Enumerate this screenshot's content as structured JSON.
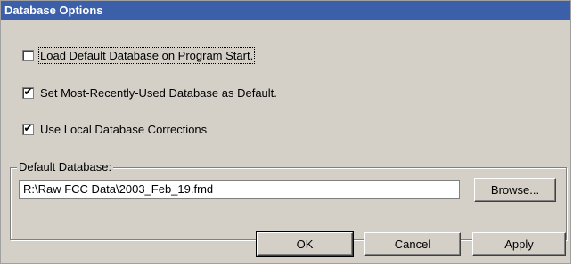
{
  "dialog": {
    "title": "Database Options"
  },
  "options": [
    {
      "label": "Load Default Database on Program Start.",
      "checked": false
    },
    {
      "label": "Set Most-Recently-Used Database as Default.",
      "checked": true
    },
    {
      "label": "Use Local Database Corrections",
      "checked": true
    }
  ],
  "default_database": {
    "group_label": "Default Database:",
    "value": "R:\\Raw FCC Data\\2003_Feb_19.fmd",
    "browse_label": "Browse..."
  },
  "buttons": {
    "ok": "OK",
    "cancel": "Cancel",
    "apply": "Apply"
  },
  "checkmark": "✔"
}
